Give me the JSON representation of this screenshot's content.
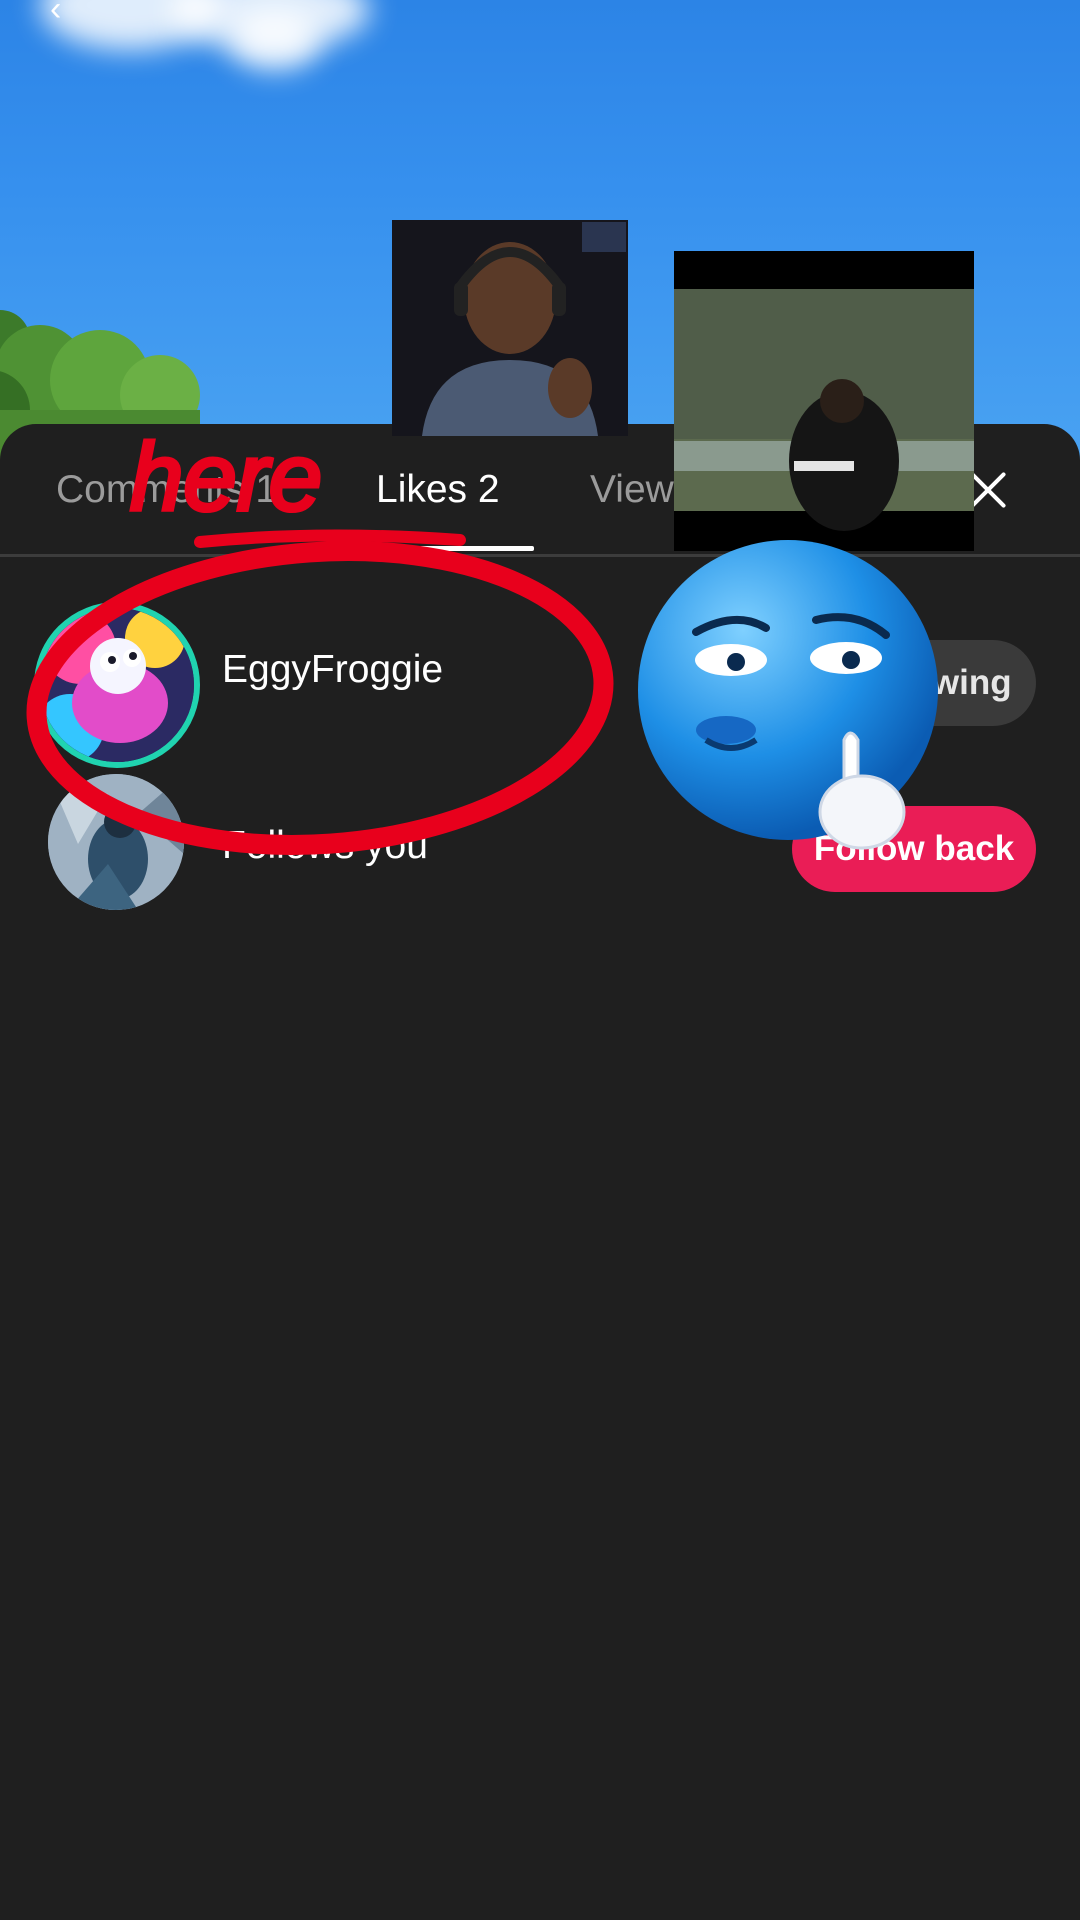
{
  "tabs": [
    {
      "label": "Comments 1"
    },
    {
      "label": "Likes 2"
    },
    {
      "label": "View"
    }
  ],
  "likes": [
    {
      "username": "EggyFroggie",
      "action": "Following"
    },
    {
      "username": "Follows you",
      "action": "Follow back"
    }
  ],
  "annotation": {
    "text": "here"
  },
  "icons": {
    "close": "close-icon",
    "back": "back-arrow-icon"
  },
  "colors": {
    "sheet": "#1f1f1f",
    "follow_back": "#ea1d56",
    "following_pill": "#3a3a3a",
    "annotation": "#e8001c"
  }
}
